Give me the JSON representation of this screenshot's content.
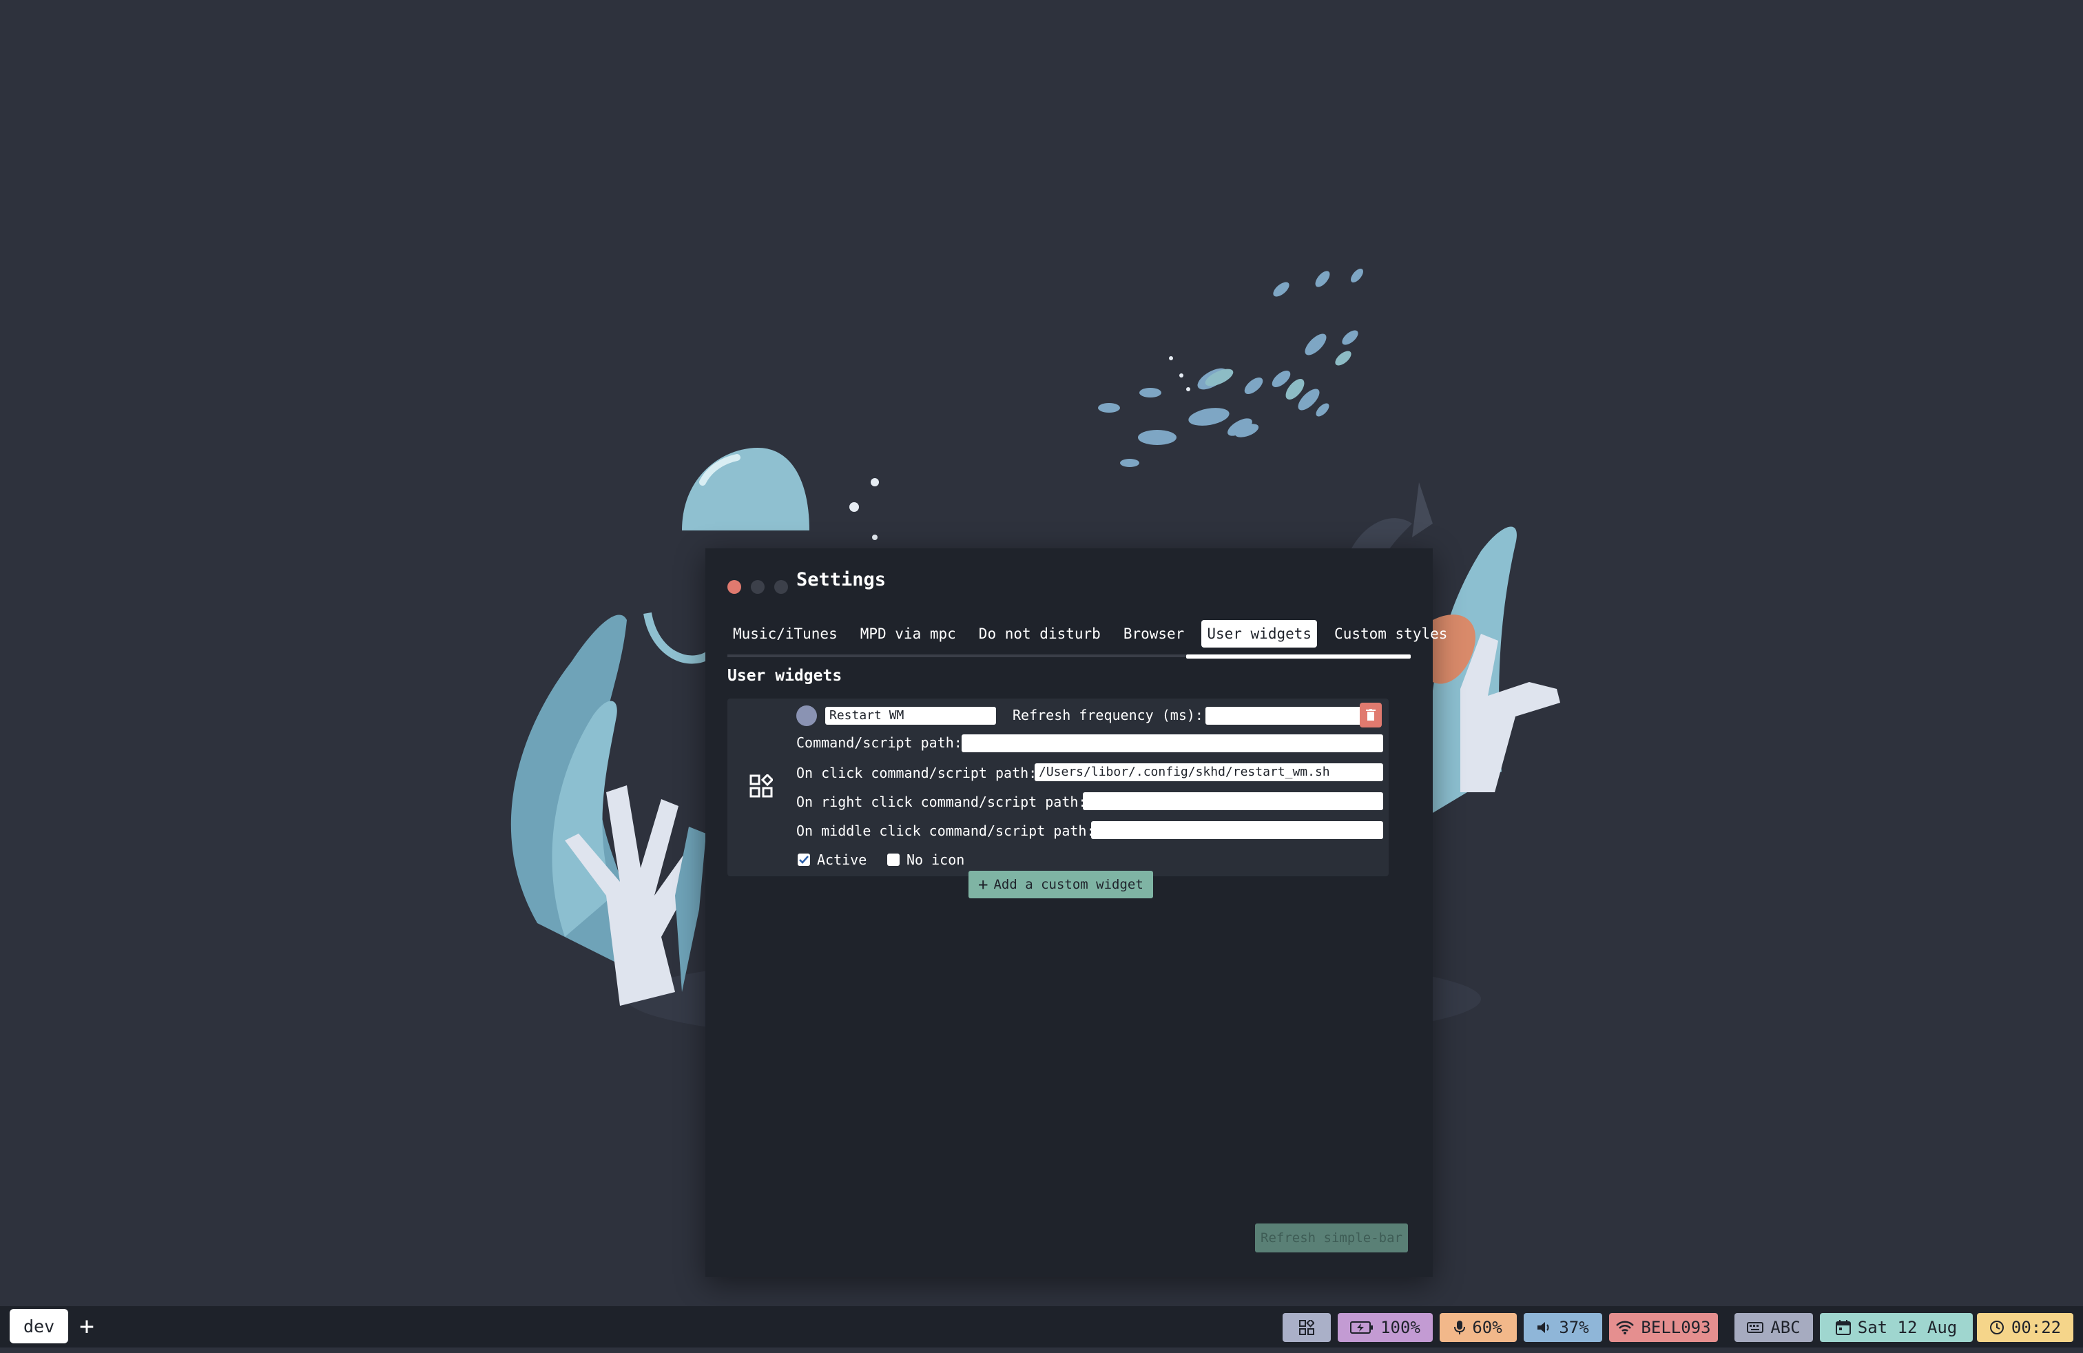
{
  "window": {
    "title": "Settings",
    "tabs": [
      {
        "label": "Music/iTunes"
      },
      {
        "label": "MPD via mpc"
      },
      {
        "label": "Do not disturb"
      },
      {
        "label": "Browser"
      },
      {
        "label": "User widgets"
      },
      {
        "label": "Custom styles"
      }
    ],
    "active_tab": "User widgets"
  },
  "user_widgets": {
    "section_title": "User widgets",
    "widget": {
      "name": "Restart WM",
      "refresh_label": "Refresh frequency (ms):",
      "refresh_value": "",
      "command_label": "Command/script path:",
      "command_value": "",
      "on_click_label": "On click command/script path:",
      "on_click_value": "/Users/libor/.config/skhd/restart_wm.sh",
      "on_right_click_label": "On right click command/script path:",
      "on_right_click_value": "",
      "on_middle_click_label": "On middle click command/script path:",
      "on_middle_click_value": "",
      "active_label": "Active",
      "active_checked": true,
      "no_icon_label": "No icon",
      "no_icon_checked": false
    },
    "add_button": "Add a custom widget",
    "refresh_button": "Refresh simple-bar"
  },
  "taskbar": {
    "space": "dev",
    "add_space": "+",
    "widgets": [
      {
        "icon": "widgets-icon",
        "label": "",
        "color": "#aab0c8"
      },
      {
        "icon": "battery-icon",
        "label": "100%",
        "color": "#c39bd3"
      },
      {
        "icon": "microphone-icon",
        "label": "60%",
        "color": "#f2b88a"
      },
      {
        "icon": "volume-icon",
        "label": "37%",
        "color": "#8fb6d8"
      },
      {
        "icon": "wifi-icon",
        "label": "BELL093",
        "color": "#e58f8f"
      },
      {
        "icon": "keyboard-icon",
        "label": "ABC",
        "color": "#a6abc0"
      },
      {
        "icon": "calendar-icon",
        "label": "Sat 12 Aug",
        "color": "#9fd6cf"
      },
      {
        "icon": "clock-icon",
        "label": "00:22",
        "color": "#f5d58a"
      }
    ]
  },
  "colors": {
    "background": "#2e323d",
    "window": "#1f232b",
    "accent_green": "#7fb4a4",
    "danger": "#e07a6f"
  }
}
